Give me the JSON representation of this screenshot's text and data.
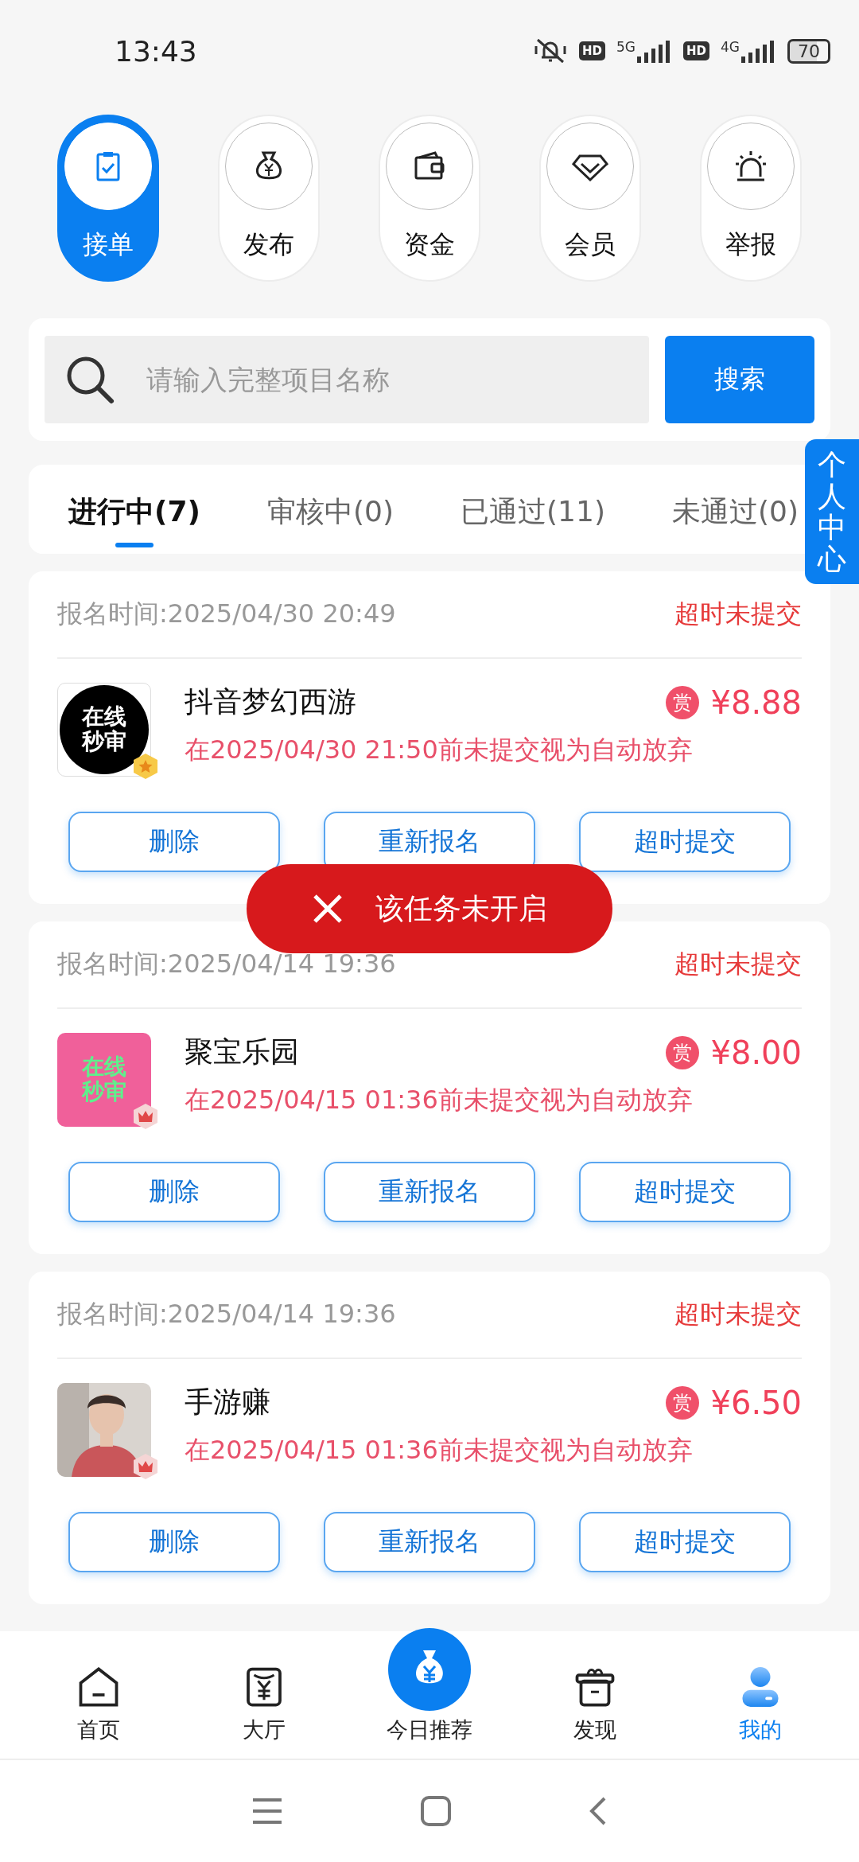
{
  "status_bar": {
    "time": "13:43",
    "networks": [
      {
        "badge": "HD",
        "generation": "5G"
      },
      {
        "badge": "HD",
        "generation": "4G"
      }
    ],
    "battery": "70"
  },
  "quick_menu": [
    {
      "label": "接单",
      "selected": true
    },
    {
      "label": "发布",
      "selected": false
    },
    {
      "label": "资金",
      "selected": false
    },
    {
      "label": "会员",
      "selected": false
    },
    {
      "label": "举报",
      "selected": false
    }
  ],
  "search": {
    "placeholder": "请输入完整项目名称",
    "button": "搜索"
  },
  "tabs": [
    {
      "label": "进行中(7)",
      "selected": true
    },
    {
      "label": "审核中(0)",
      "selected": false
    },
    {
      "label": "已通过(11)",
      "selected": false
    },
    {
      "label": "未通过(0)",
      "selected": false
    }
  ],
  "side_tab": {
    "label": "个人中心"
  },
  "tasks": [
    {
      "signup_time": "报名时间:2025/04/30 20:49",
      "status": "超时未提交",
      "avatar": {
        "kind": "dark-logo",
        "text": "在线秒审",
        "badge": {
          "kind": "star"
        }
      },
      "title": "抖音梦幻西游",
      "reward_mark": "赏",
      "price": "¥8.88",
      "deadline_note": "在2025/04/30 21:50前未提交视为自动放弃",
      "buttons": [
        "删除",
        "重新报名",
        "超时提交"
      ]
    },
    {
      "signup_time": "报名时间:2025/04/14 19:36",
      "status": "超时未提交",
      "avatar": {
        "kind": "pink-logo",
        "text": "在线秒审",
        "badge": {
          "kind": "crown"
        }
      },
      "title": "聚宝乐园",
      "reward_mark": "赏",
      "price": "¥8.00",
      "deadline_note": "在2025/04/15 01:36前未提交视为自动放弃",
      "buttons": [
        "删除",
        "重新报名",
        "超时提交"
      ]
    },
    {
      "signup_time": "报名时间:2025/04/14 19:36",
      "status": "超时未提交",
      "avatar": {
        "kind": "picture",
        "badge": {
          "kind": "crown"
        }
      },
      "title": "手游赚",
      "reward_mark": "赏",
      "price": "¥6.50",
      "deadline_note": "在2025/04/15 01:36前未提交视为自动放弃",
      "buttons": [
        "删除",
        "重新报名",
        "超时提交"
      ]
    }
  ],
  "toast": {
    "text": "该任务未开启"
  },
  "bottom_nav": [
    {
      "label": "首页",
      "kind": "tab",
      "selected": false
    },
    {
      "label": "大厅",
      "kind": "tab",
      "selected": false
    },
    {
      "label": "今日推荐",
      "kind": "featured",
      "selected": false
    },
    {
      "label": "发现",
      "kind": "tab",
      "selected": false
    },
    {
      "label": "我的",
      "kind": "tab",
      "selected": true
    }
  ]
}
